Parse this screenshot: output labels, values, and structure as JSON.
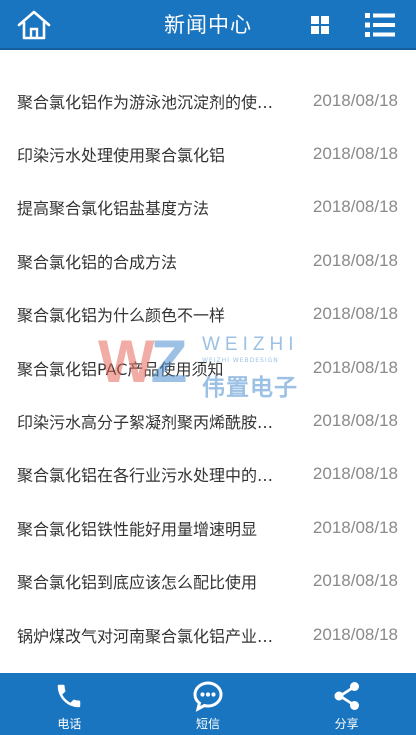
{
  "header": {
    "title": "新闻中心",
    "home_icon": "home-icon",
    "grid_icon": "grid-icon",
    "menu_icon": "menu-list-icon"
  },
  "news": [
    {
      "title": "聚合氯化铝作为游泳池沉淀剂的使用方法",
      "date": "2018/08/18"
    },
    {
      "title": "印染污水处理使用聚合氯化铝",
      "date": "2018/08/18"
    },
    {
      "title": "提高聚合氯化铝盐基度方法",
      "date": "2018/08/18"
    },
    {
      "title": "聚合氯化铝的合成方法",
      "date": "2018/08/18"
    },
    {
      "title": "聚合氯化铝为什么颜色不一样",
      "date": "2018/08/18"
    },
    {
      "title": "聚合氯化铝PAC产品使用须知",
      "date": "2018/08/18"
    },
    {
      "title": "印染污水高分子絮凝剂聚丙烯酰胺的选用",
      "date": "2018/08/18"
    },
    {
      "title": "聚合氯化铝在各行业污水处理中的应用",
      "date": "2018/08/18"
    },
    {
      "title": "聚合氯化铝铁性能好用量增速明显",
      "date": "2018/08/18"
    },
    {
      "title": "聚合氯化铝到底应该怎么配比使用",
      "date": "2018/08/18"
    },
    {
      "title": "锅炉煤改气对河南聚合氯化铝产业的影响",
      "date": "2018/08/18"
    }
  ],
  "watermark": {
    "logo": "WZ",
    "brand": "WEIZHI",
    "sub": "WEIZHI WEBDESIGN",
    "cn": "伟置电子"
  },
  "footer": {
    "items": [
      {
        "label": "电话",
        "icon": "phone-icon"
      },
      {
        "label": "短信",
        "icon": "sms-icon"
      },
      {
        "label": "分享",
        "icon": "share-icon"
      }
    ]
  },
  "colors": {
    "bar": "#1a75c0",
    "text": "#333333",
    "date": "#8a8a8a"
  }
}
